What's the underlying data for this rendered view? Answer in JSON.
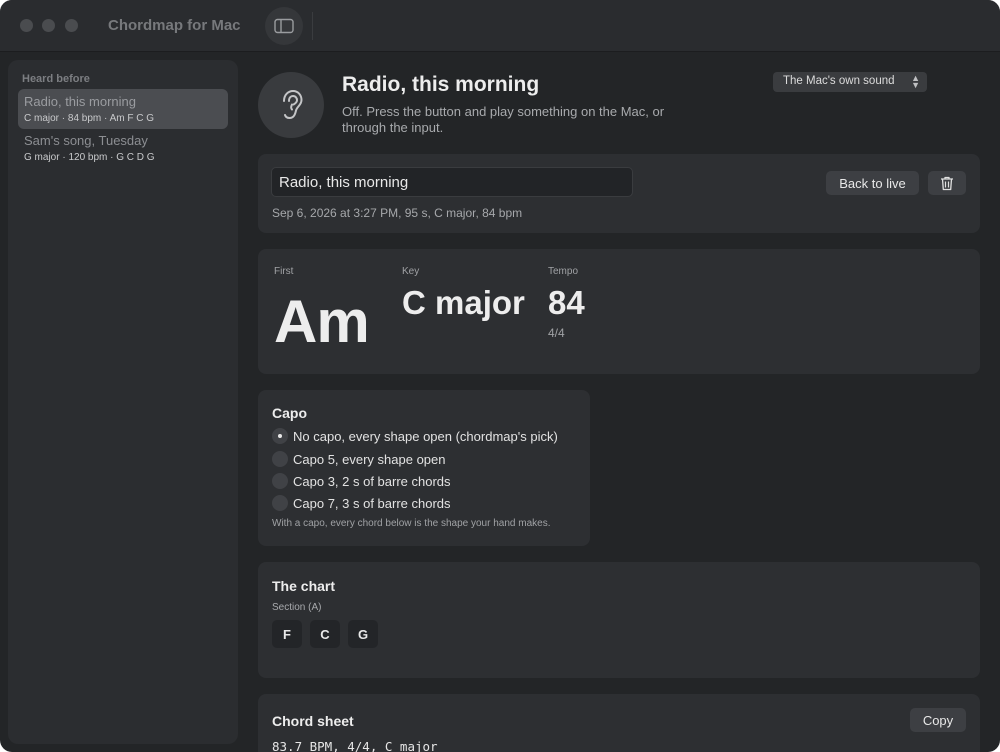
{
  "app": {
    "title": "Chordmap for Mac"
  },
  "sidebar": {
    "heading": "Heard before",
    "items": [
      {
        "title": "Radio, this morning",
        "subtitle": "C major · 84 bpm · Am F C G",
        "selected": true
      },
      {
        "title": "Sam's song, Tuesday",
        "subtitle": "G major · 120 bpm · G C D G",
        "selected": false
      }
    ]
  },
  "header": {
    "title": "Radio, this morning",
    "subtitle": "Off. Press the button and play something on the Mac, or through the input.",
    "source": "The Mac's own sound"
  },
  "recording": {
    "name_value": "Radio, this morning",
    "meta": "Sep 6, 2026 at 3:27 PM, 95 s, C major, 84 bpm",
    "back_label": "Back to live"
  },
  "stats": {
    "first_label": "First",
    "first_value": "Am",
    "key_label": "Key",
    "key_value": "C major",
    "tempo_label": "Tempo",
    "tempo_value": "84",
    "meter": "4/4"
  },
  "capo": {
    "title": "Capo",
    "options": [
      {
        "label": "No capo, every shape open  (chordmap's pick)",
        "selected": true
      },
      {
        "label": "Capo 5, every shape open",
        "selected": false
      },
      {
        "label": "Capo 3, 2 s of barre chords",
        "selected": false
      },
      {
        "label": "Capo 7, 3 s of barre chords",
        "selected": false
      }
    ],
    "note": "With a capo, every chord below is the shape your hand makes."
  },
  "chart": {
    "title": "The chart",
    "section": "Section (A)",
    "chords": [
      "F",
      "C",
      "G"
    ]
  },
  "sheet": {
    "title": "Chord sheet",
    "copy_label": "Copy",
    "first_line": "83.7 BPM, 4/4, C major"
  },
  "colors": {
    "window_bg": "#232527",
    "card_bg": "#2d2f32",
    "selected_bg": "#4b4d51"
  },
  "icons": {
    "sidebar_toggle": "sidebar-toggle-icon",
    "ear": "ear-icon",
    "trash": "trash-icon",
    "select": "chevron-up-down-icon"
  }
}
